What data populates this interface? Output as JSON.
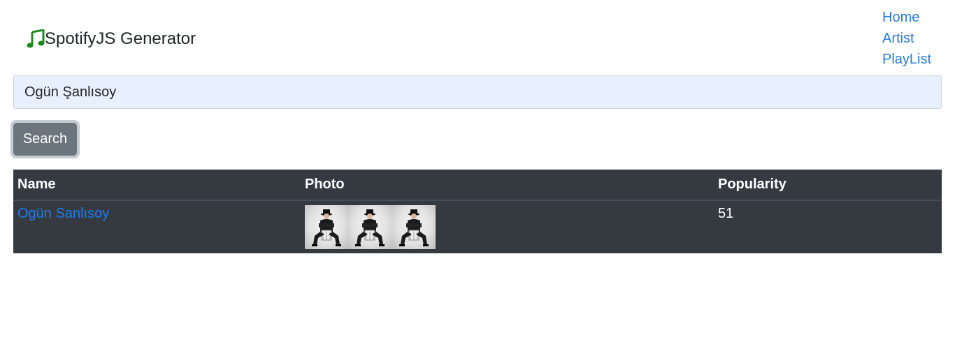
{
  "brand": {
    "title": "SpotifyJS Generator",
    "icon": "music-note-icon",
    "icon_color": "#1f8a1f"
  },
  "nav": {
    "items": [
      {
        "label": "Home"
      },
      {
        "label": "Artist"
      },
      {
        "label": "PlayList"
      }
    ],
    "link_color": "#2a7ad8"
  },
  "search": {
    "value": "Ogün Şanlısoy",
    "button_label": "Search"
  },
  "table": {
    "headers": {
      "name": "Name",
      "photo": "Photo",
      "popularity": "Popularity"
    },
    "rows": [
      {
        "name": "Ogün Sanlısoy",
        "photos": [
          "artist-photo",
          "artist-photo",
          "artist-photo"
        ],
        "popularity": "51"
      }
    ],
    "background": "#343a40"
  }
}
